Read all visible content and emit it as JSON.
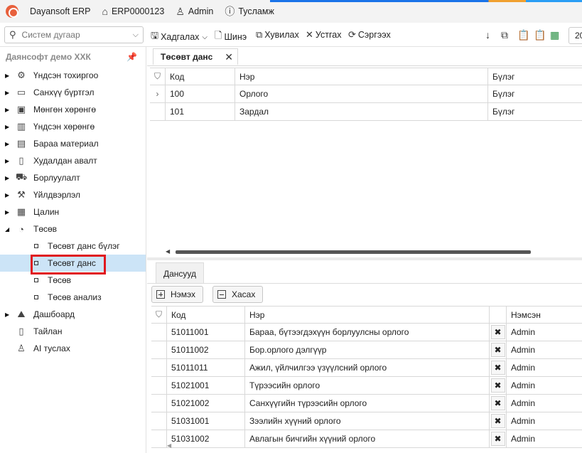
{
  "app": {
    "title": "Dayansoft ERP",
    "company_code": "ERP0000123",
    "user": "Admin",
    "help": "Тусламж"
  },
  "toolbar": {
    "search_placeholder": "Систем дугаар",
    "save": "Хадгалах",
    "new": "Шинэ",
    "copy": "Хувилах",
    "delete": "Устгах",
    "refresh": "Сэргээх",
    "year": "20"
  },
  "sidebar": {
    "header": "Даянсофт демо ХХК",
    "items": [
      {
        "label": "Үндсэн тохиргоо",
        "icon": "gear-icon"
      },
      {
        "label": "Санхүү бүртгэл",
        "icon": "wallet-icon"
      },
      {
        "label": "Мөнгөн хөрөнгө",
        "icon": "money-icon"
      },
      {
        "label": "Үндсэн хөрөнгө",
        "icon": "building-icon"
      },
      {
        "label": "Бараа материал",
        "icon": "box-icon"
      },
      {
        "label": "Худалдан авалт",
        "icon": "cart-icon"
      },
      {
        "label": "Борлуулалт",
        "icon": "sales-icon"
      },
      {
        "label": "Үйлдвэрлэл",
        "icon": "factory-icon"
      },
      {
        "label": "Цалин",
        "icon": "calculator-icon"
      },
      {
        "label": "Төсөв",
        "icon": "pie-icon"
      }
    ],
    "budget_children": [
      {
        "label": "Төсөвт данс бүлэг"
      },
      {
        "label": "Төсөвт данс"
      },
      {
        "label": "Төсөв"
      },
      {
        "label": "Төсөв анализ"
      }
    ],
    "bottom_items": [
      {
        "label": "Дашбоард",
        "icon": "dashboard-icon"
      },
      {
        "label": "Тайлан",
        "icon": "report-icon"
      },
      {
        "label": "AI туслах",
        "icon": "ai-icon"
      }
    ]
  },
  "document_tab": {
    "label": "Төсөвт данс"
  },
  "grid1": {
    "headers": {
      "code": "Код",
      "name": "Нэр",
      "group": "Бүлэг"
    },
    "rows": [
      {
        "code": "100",
        "name": "Орлого",
        "group": "Бүлэг"
      },
      {
        "code": "101",
        "name": "Зардал",
        "group": "Бүлэг"
      }
    ]
  },
  "detail_tab": {
    "label": "Дансууд"
  },
  "detail_buttons": {
    "add": "Нэмэх",
    "remove": "Хасах"
  },
  "grid2": {
    "headers": {
      "code": "Код",
      "name": "Нэр",
      "added_by": "Нэмсэн"
    },
    "rows": [
      {
        "code": "51011001",
        "name": "Бараа, бүтээгдэхүүн борлуулсны орлого",
        "added_by": "Admin"
      },
      {
        "code": "51011002",
        "name": "Бор.орлого дэлгүүр",
        "added_by": "Admin"
      },
      {
        "code": "51011011",
        "name": "Ажил, үйлчилгээ үзүүлсний орлого",
        "added_by": "Admin"
      },
      {
        "code": "51021001",
        "name": "Түрээсийн орлого",
        "added_by": "Admin"
      },
      {
        "code": "51021002",
        "name": "Санхүүгийн түрээсийн орлого",
        "added_by": "Admin"
      },
      {
        "code": "51031001",
        "name": "Зээлийн хүүний орлого",
        "added_by": "Admin"
      },
      {
        "code": "51031002",
        "name": "Авлагын бичгийн хүүний орлого",
        "added_by": "Admin"
      }
    ]
  }
}
